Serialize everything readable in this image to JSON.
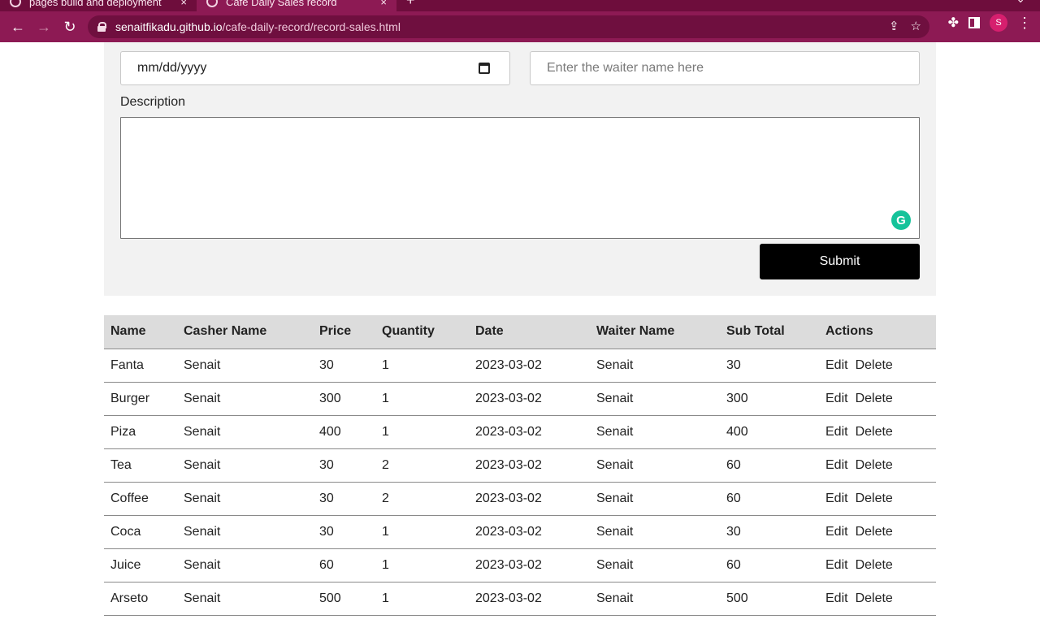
{
  "browser": {
    "tabs": [
      {
        "title": "pages build and deployment",
        "close": "×"
      },
      {
        "title": "Cafe Daily Sales record",
        "close": "×"
      }
    ],
    "new_tab": "+",
    "chevron": "⌄",
    "url_host": "senaitfikadu.github.io",
    "url_path": "/cafe-daily-record/record-sales.html",
    "profile_initial": "S",
    "icons": {
      "back": "←",
      "forward": "→",
      "reload": "↻",
      "share": "⇪",
      "star": "☆",
      "extensions": "✤",
      "menu": "⋮"
    }
  },
  "form": {
    "date_placeholder": "mm/dd/yyyy",
    "waiter_placeholder": "Enter the waiter name here",
    "description_label": "Description",
    "grammarly_letter": "G",
    "submit_label": "Submit"
  },
  "table": {
    "headers": [
      "Name",
      "Casher Name",
      "Price",
      "Quantity",
      "Date",
      "Waiter Name",
      "Sub Total",
      "Actions"
    ],
    "edit_label": "Edit",
    "delete_label": "Delete",
    "rows": [
      [
        "Fanta",
        "Senait",
        "30",
        "1",
        "2023-03-02",
        "Senait",
        "30"
      ],
      [
        "Burger",
        "Senait",
        "300",
        "1",
        "2023-03-02",
        "Senait",
        "300"
      ],
      [
        "Piza",
        "Senait",
        "400",
        "1",
        "2023-03-02",
        "Senait",
        "400"
      ],
      [
        "Tea",
        "Senait",
        "30",
        "2",
        "2023-03-02",
        "Senait",
        "60"
      ],
      [
        "Coffee",
        "Senait",
        "30",
        "2",
        "2023-03-02",
        "Senait",
        "60"
      ],
      [
        "Coca",
        "Senait",
        "30",
        "1",
        "2023-03-02",
        "Senait",
        "30"
      ],
      [
        "Juice",
        "Senait",
        "60",
        "1",
        "2023-03-02",
        "Senait",
        "60"
      ],
      [
        "Arseto",
        "Senait",
        "500",
        "1",
        "2023-03-02",
        "Senait",
        "500"
      ]
    ]
  }
}
